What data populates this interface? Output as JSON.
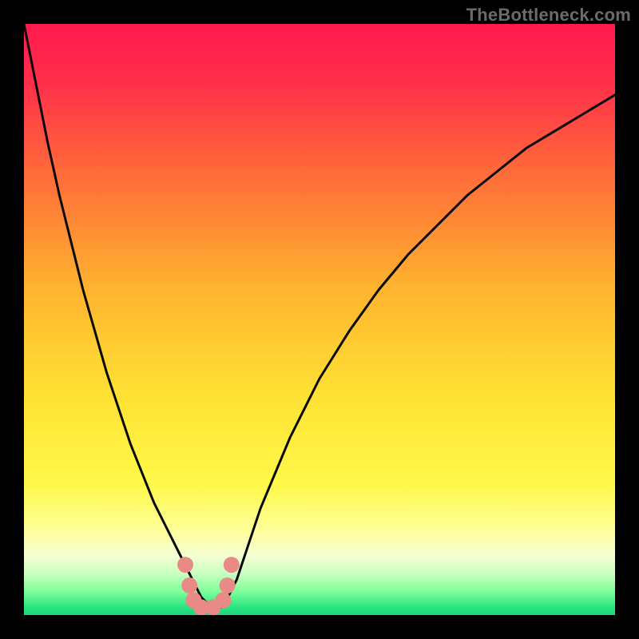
{
  "watermark": "TheBottleneck.com",
  "colors": {
    "frame": "#000000",
    "gradient_stops": [
      {
        "pos": 0.0,
        "color": "#ff1a4d"
      },
      {
        "pos": 0.1,
        "color": "#ff2f4a"
      },
      {
        "pos": 0.25,
        "color": "#ff6a3a"
      },
      {
        "pos": 0.45,
        "color": "#ffb42f"
      },
      {
        "pos": 0.63,
        "color": "#ffe233"
      },
      {
        "pos": 0.78,
        "color": "#fff94a"
      },
      {
        "pos": 0.86,
        "color": "#feff9e"
      },
      {
        "pos": 0.9,
        "color": "#f4ffd4"
      },
      {
        "pos": 0.93,
        "color": "#c8ffc0"
      },
      {
        "pos": 0.96,
        "color": "#7fff9a"
      },
      {
        "pos": 0.985,
        "color": "#2fe682"
      },
      {
        "pos": 1.0,
        "color": "#1fd67a"
      }
    ],
    "curve": "#0a0a0a",
    "marker": "#e98a87"
  },
  "chart_data": {
    "type": "line",
    "title": "",
    "xlabel": "",
    "ylabel": "",
    "xlim": [
      0,
      100
    ],
    "ylim": [
      0,
      100
    ],
    "grid": false,
    "series": [
      {
        "name": "bottleneck-curve",
        "x": [
          0,
          2,
          4,
          6,
          8,
          10,
          12,
          14,
          16,
          18,
          20,
          22,
          24,
          26,
          27,
          28,
          29,
          30,
          31,
          32,
          33,
          34,
          36,
          38,
          40,
          45,
          50,
          55,
          60,
          65,
          70,
          75,
          80,
          85,
          90,
          95,
          100
        ],
        "y": [
          100,
          90,
          80,
          71,
          63,
          55,
          48,
          41,
          35,
          29,
          24,
          19,
          15,
          11,
          9,
          7,
          5,
          3,
          2,
          1,
          1,
          2,
          6,
          12,
          18,
          30,
          40,
          48,
          55,
          61,
          66,
          71,
          75,
          79,
          82,
          85,
          88
        ]
      }
    ],
    "annotations": [
      {
        "name": "marker-left-top",
        "x": 27.3,
        "y": 8.5
      },
      {
        "name": "marker-left-mid",
        "x": 28.0,
        "y": 5.0
      },
      {
        "name": "marker-left-bottom",
        "x": 28.7,
        "y": 2.5
      },
      {
        "name": "marker-bottom-1",
        "x": 30.0,
        "y": 1.3
      },
      {
        "name": "marker-bottom-2",
        "x": 32.0,
        "y": 1.3
      },
      {
        "name": "marker-right-bottom",
        "x": 33.7,
        "y": 2.5
      },
      {
        "name": "marker-right-mid",
        "x": 34.4,
        "y": 5.0
      },
      {
        "name": "marker-right-top",
        "x": 35.1,
        "y": 8.5
      }
    ]
  }
}
